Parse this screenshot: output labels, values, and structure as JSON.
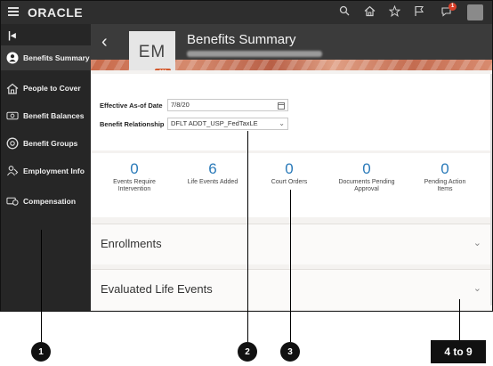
{
  "topbar": {
    "logo": "ORACLE",
    "notification_count": "1",
    "icons": [
      "menu-icon",
      "search-icon",
      "home-icon",
      "star-icon",
      "flag-icon",
      "notifications-icon",
      "user-avatar"
    ]
  },
  "sidebar": {
    "items": [
      {
        "label": "Benefits Summary",
        "icon": "person-icon",
        "active": true
      },
      {
        "label": "People to Cover",
        "icon": "house-icon"
      },
      {
        "label": "Benefit Balances",
        "icon": "balances-icon"
      },
      {
        "label": "Benefit Groups",
        "icon": "groups-icon"
      },
      {
        "label": "Employment Info",
        "icon": "employment-icon"
      },
      {
        "label": "Compensation",
        "icon": "compensation-icon"
      }
    ]
  },
  "header": {
    "initials": "EM",
    "title": "Benefits Summary",
    "more": "•••"
  },
  "form": {
    "effective_label": "Effective As-of Date",
    "effective_value": "7/8/20",
    "relationship_label": "Benefit Relationship",
    "relationship_value": "DFLT ADDT_USP_FedTaxLE"
  },
  "stats": [
    {
      "value": "0",
      "label": "Events Require Intervention"
    },
    {
      "value": "6",
      "label": "Life Events Added"
    },
    {
      "value": "0",
      "label": "Court Orders"
    },
    {
      "value": "0",
      "label": "Documents Pending Approval"
    },
    {
      "value": "0",
      "label": "Pending Action Items"
    }
  ],
  "sections": [
    {
      "title": "Enrollments"
    },
    {
      "title": "Evaluated Life Events"
    }
  ],
  "callouts": [
    "1",
    "2",
    "3",
    "4 to 9"
  ],
  "colors": {
    "accent": "#2a7ab9",
    "badge": "#d35a2e",
    "dark": "#2b2b2b"
  }
}
